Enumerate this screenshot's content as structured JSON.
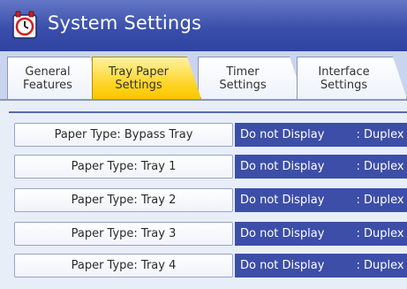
{
  "header": {
    "title": "System Settings",
    "icon": "clock-settings-icon"
  },
  "tabs": [
    {
      "label": "General\nFeatures",
      "active": false
    },
    {
      "label": "Tray Paper\nSettings",
      "active": true
    },
    {
      "label": "Timer\nSettings",
      "active": false
    },
    {
      "label": "Interface\nSettings",
      "active": false
    }
  ],
  "rows": [
    {
      "label": "Paper Type: Bypass Tray",
      "display": "Do not Display",
      "duplex": ": Duplex C"
    },
    {
      "label": "Paper Type: Tray 1",
      "display": "Do not Display",
      "duplex": ": Duplex C"
    },
    {
      "label": "Paper Type: Tray 2",
      "display": "Do not Display",
      "duplex": ": Duplex C"
    },
    {
      "label": "Paper Type: Tray 3",
      "display": "Do not Display",
      "duplex": ": Duplex C"
    },
    {
      "label": "Paper Type: Tray 4",
      "display": "Do not Display",
      "duplex": ": Duplex C"
    }
  ],
  "colors": {
    "header_blue": "#3a4fab",
    "active_tab_yellow": "#ffd21e",
    "value_cell_blue": "#3d4ea8"
  }
}
